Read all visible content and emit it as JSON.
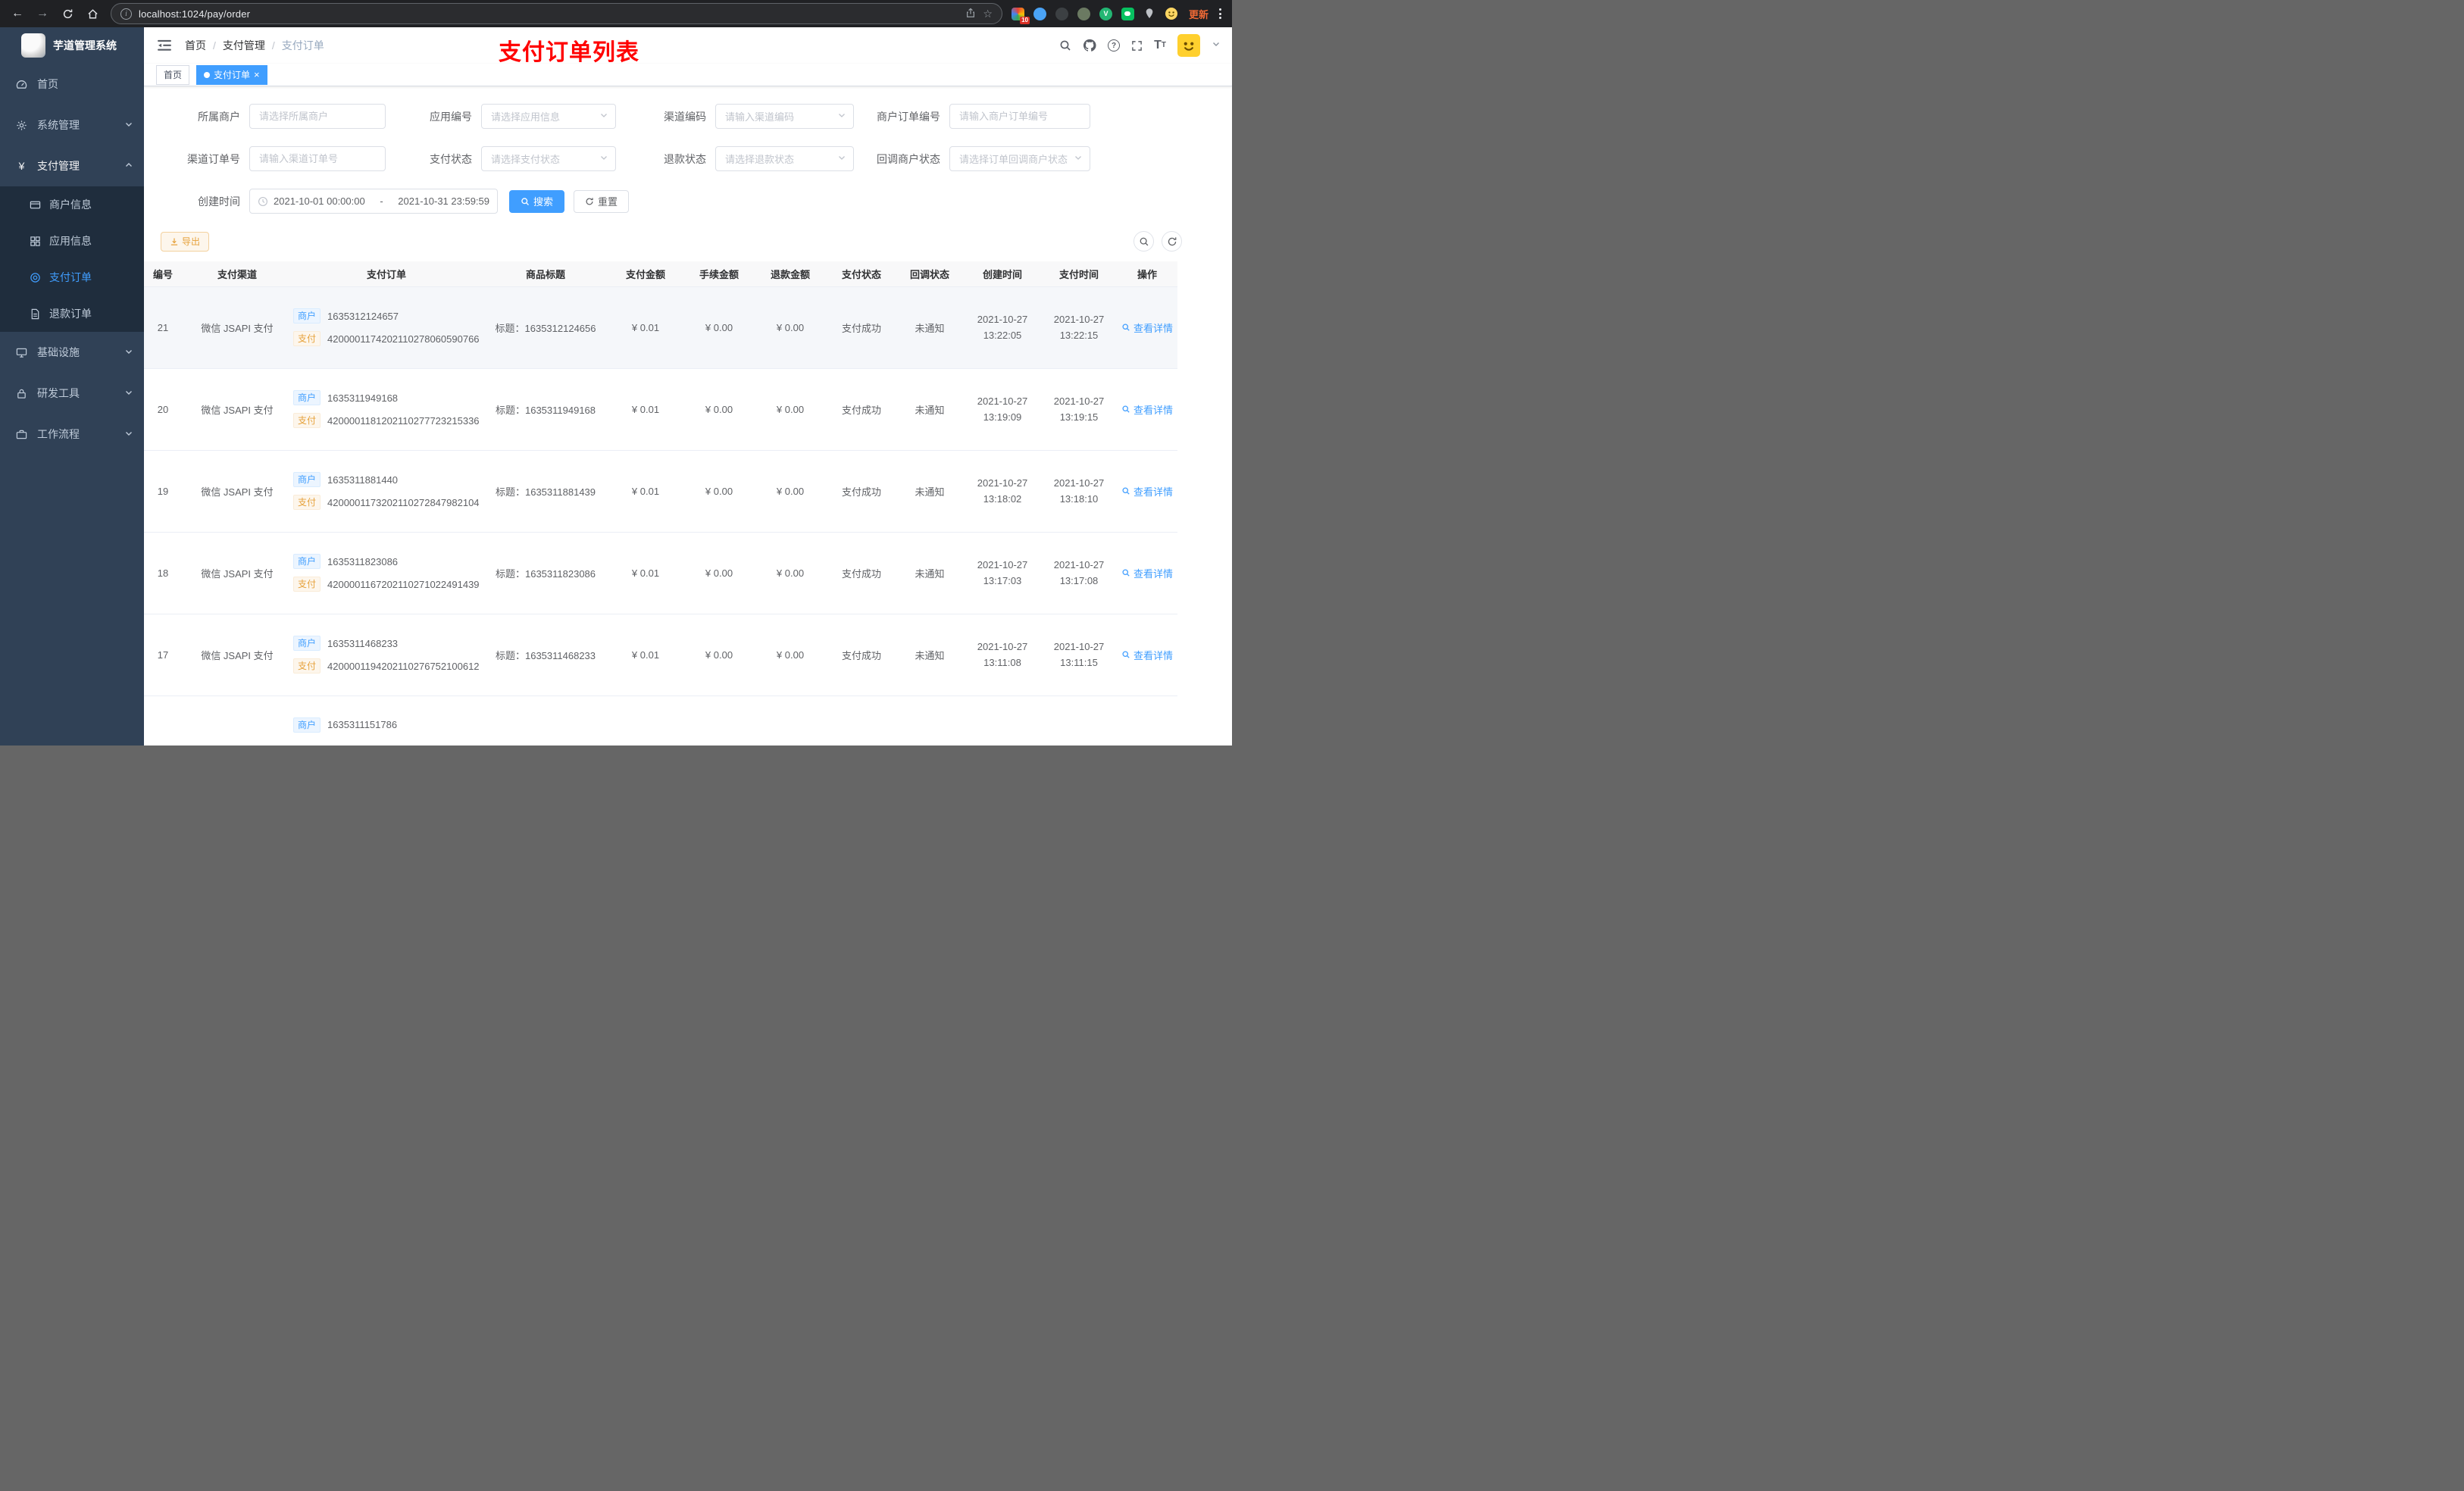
{
  "browser": {
    "url": "localhost:1024/pay/order",
    "badge": "10",
    "update": "更新"
  },
  "app": {
    "title": "芋道管理系统"
  },
  "menu": {
    "home": "首页",
    "system": "系统管理",
    "pay": "支付管理",
    "merchant_info": "商户信息",
    "app_info": "应用信息",
    "pay_order": "支付订单",
    "refund_order": "退款订单",
    "infra": "基础设施",
    "dev_tools": "研发工具",
    "workflow": "工作流程"
  },
  "breadcrumb": {
    "home": "首页",
    "pay": "支付管理",
    "current": "支付订单",
    "separator": "/"
  },
  "annotation": "支付订单列表",
  "tabs": {
    "home": "首页",
    "current": "支付订单"
  },
  "filters": {
    "merchant": {
      "label": "所属商户",
      "placeholder": "请选择所属商户"
    },
    "app_no": {
      "label": "应用编号",
      "placeholder": "请选择应用信息"
    },
    "channel_code": {
      "label": "渠道编码",
      "placeholder": "请输入渠道编码"
    },
    "merchant_order_no": {
      "label": "商户订单编号",
      "placeholder": "请输入商户订单编号"
    },
    "channel_order_no": {
      "label": "渠道订单号",
      "placeholder": "请输入渠道订单号"
    },
    "pay_status": {
      "label": "支付状态",
      "placeholder": "请选择支付状态"
    },
    "refund_status": {
      "label": "退款状态",
      "placeholder": "请选择退款状态"
    },
    "notify_status": {
      "label": "回调商户状态",
      "placeholder": "请选择订单回调商户状态"
    },
    "create_time": {
      "label": "创建时间",
      "start": "2021-10-01 00:00:00",
      "separator": "-",
      "end": "2021-10-31 23:59:59"
    },
    "search": "搜索",
    "reset": "重置"
  },
  "toolbar": {
    "export": "导出"
  },
  "table": {
    "columns": {
      "id": "编号",
      "channel": "支付渠道",
      "order": "支付订单",
      "title": "商品标题",
      "amount": "支付金额",
      "fee": "手续金额",
      "refund": "退款金额",
      "status": "支付状态",
      "notify": "回调状态",
      "created": "创建时间",
      "paid": "支付时间",
      "action": "操作"
    },
    "tag_merchant": "商户",
    "tag_pay": "支付",
    "rows": [
      {
        "id": "21",
        "channel": "微信 JSAPI 支付",
        "merchant_no": "1635312124657",
        "pay_no": "4200001174202110278060590766",
        "title": "标题：1635312124656",
        "amount": "¥ 0.01",
        "fee": "¥ 0.00",
        "refund": "¥ 0.00",
        "status": "支付成功",
        "notify": "未通知",
        "created_date": "2021-10-27",
        "created_time": "13:22:05",
        "paid_date": "2021-10-27",
        "paid_time": "13:22:15",
        "action": "查看详情"
      },
      {
        "id": "20",
        "channel": "微信 JSAPI 支付",
        "merchant_no": "1635311949168",
        "pay_no": "4200001181202110277723215336",
        "title": "标题：1635311949168",
        "amount": "¥ 0.01",
        "fee": "¥ 0.00",
        "refund": "¥ 0.00",
        "status": "支付成功",
        "notify": "未通知",
        "created_date": "2021-10-27",
        "created_time": "13:19:09",
        "paid_date": "2021-10-27",
        "paid_time": "13:19:15",
        "action": "查看详情"
      },
      {
        "id": "19",
        "channel": "微信 JSAPI 支付",
        "merchant_no": "1635311881440",
        "pay_no": "4200001173202110272847982104",
        "title": "标题：1635311881439",
        "amount": "¥ 0.01",
        "fee": "¥ 0.00",
        "refund": "¥ 0.00",
        "status": "支付成功",
        "notify": "未通知",
        "created_date": "2021-10-27",
        "created_time": "13:18:02",
        "paid_date": "2021-10-27",
        "paid_time": "13:18:10",
        "action": "查看详情"
      },
      {
        "id": "18",
        "channel": "微信 JSAPI 支付",
        "merchant_no": "1635311823086",
        "pay_no": "4200001167202110271022491439",
        "title": "标题：1635311823086",
        "amount": "¥ 0.01",
        "fee": "¥ 0.00",
        "refund": "¥ 0.00",
        "status": "支付成功",
        "notify": "未通知",
        "created_date": "2021-10-27",
        "created_time": "13:17:03",
        "paid_date": "2021-10-27",
        "paid_time": "13:17:08",
        "action": "查看详情"
      },
      {
        "id": "17",
        "channel": "微信 JSAPI 支付",
        "merchant_no": "1635311468233",
        "pay_no": "4200001194202110276752100612",
        "title": "标题：1635311468233",
        "amount": "¥ 0.01",
        "fee": "¥ 0.00",
        "refund": "¥ 0.00",
        "status": "支付成功",
        "notify": "未通知",
        "created_date": "2021-10-27",
        "created_time": "13:11:08",
        "paid_date": "2021-10-27",
        "paid_time": "13:11:15",
        "action": "查看详情"
      }
    ],
    "partial_row": {
      "merchant_no": "1635311151786"
    }
  }
}
